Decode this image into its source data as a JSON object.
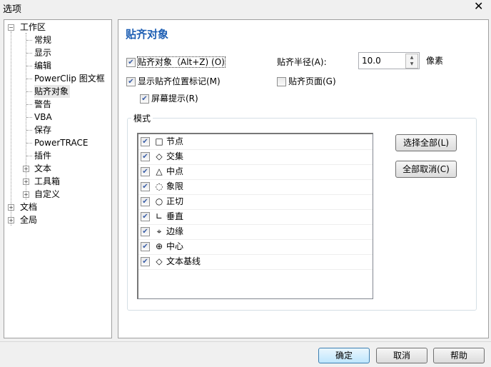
{
  "window": {
    "title": "选项",
    "close": "✕"
  },
  "tree": [
    {
      "label": "工作区",
      "level": 0,
      "expander": "−"
    },
    {
      "label": "常规",
      "level": 1
    },
    {
      "label": "显示",
      "level": 1
    },
    {
      "label": "编辑",
      "level": 1
    },
    {
      "label": "PowerClip 图文框",
      "level": 1
    },
    {
      "label": "贴齐对象",
      "level": 1,
      "selected": true
    },
    {
      "label": "警告",
      "level": 1
    },
    {
      "label": "VBA",
      "level": 1
    },
    {
      "label": "保存",
      "level": 1
    },
    {
      "label": "PowerTRACE",
      "level": 1
    },
    {
      "label": "插件",
      "level": 1
    },
    {
      "label": "文本",
      "level": 1,
      "expander": "+"
    },
    {
      "label": "工具箱",
      "level": 1,
      "expander": "+"
    },
    {
      "label": "自定义",
      "level": 1,
      "expander": "+"
    },
    {
      "label": "文档",
      "level": 0,
      "expander": "+"
    },
    {
      "label": "全局",
      "level": 0,
      "expander": "+"
    }
  ],
  "panel": {
    "heading": "贴齐对象",
    "snap_objects": {
      "label": "贴齐对象（Alt+Z) (O)",
      "checked": true
    },
    "show_marker": {
      "label": "显示贴齐位置标记(M)",
      "checked": true
    },
    "screen_tips": {
      "label": "屏幕提示(R)",
      "checked": true
    },
    "radius_label": "贴齐半径(A):",
    "radius_value": "10.0",
    "radius_unit": "像素",
    "snap_page": {
      "label": "贴齐页面(G)",
      "checked": false
    },
    "mode_label": "模式",
    "modes": [
      {
        "symbol": "□",
        "label": "节点",
        "checked": true
      },
      {
        "symbol": "◇",
        "label": "交集",
        "checked": true
      },
      {
        "symbol": "△",
        "label": "中点",
        "checked": true
      },
      {
        "symbol": "◌",
        "label": "象限",
        "checked": true
      },
      {
        "symbol": "○",
        "label": "正切",
        "checked": true
      },
      {
        "symbol": "∟",
        "label": "垂直",
        "checked": true
      },
      {
        "symbol": "⌖",
        "label": "边缘",
        "checked": true
      },
      {
        "symbol": "⊕",
        "label": "中心",
        "checked": true
      },
      {
        "symbol": "◇",
        "label": "文本基线",
        "checked": true
      }
    ],
    "select_all": "选择全部(L)",
    "deselect_all": "全部取消(C)"
  },
  "footer": {
    "ok": "确定",
    "cancel": "取消",
    "help": "帮助"
  }
}
